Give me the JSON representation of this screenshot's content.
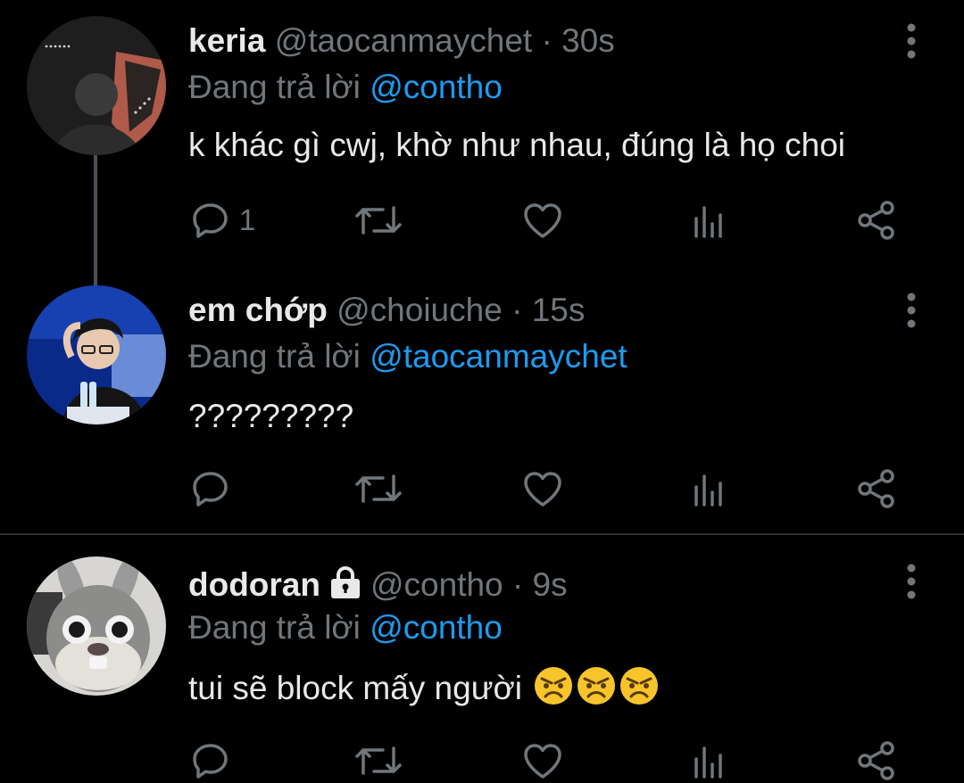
{
  "tweets": [
    {
      "name": "keria",
      "handle": "@taocanmaychet",
      "separator": "·",
      "time": "30s",
      "reply_prefix": "Đang trả lời",
      "reply_to": "@contho",
      "text": "k khác gì cwj, khờ như nhau, đúng là họ choi",
      "reply_count": "1",
      "locked": false
    },
    {
      "name": "em chớp",
      "handle": "@choiuche",
      "separator": "·",
      "time": "15s",
      "reply_prefix": "Đang trả lời",
      "reply_to": "@taocanmaychet",
      "text": "?????????",
      "reply_count": "",
      "locked": false
    },
    {
      "name": "dodoran",
      "handle": "@contho",
      "separator": "·",
      "time": "9s",
      "reply_prefix": "Đang trả lời",
      "reply_to": "@contho",
      "text": "tui sẽ block mấy người",
      "reply_count": "",
      "locked": true,
      "emojis": [
        "angry-face",
        "angry-face",
        "angry-face"
      ]
    }
  ],
  "icons": {
    "reply": "reply-icon",
    "retweet": "retweet-icon",
    "like": "heart-icon",
    "analytics": "analytics-icon",
    "share": "share-icon",
    "more": "more-icon",
    "lock": "lock-icon"
  },
  "colors": {
    "background": "#000000",
    "text": "#e7e9ea",
    "secondary": "#71767b",
    "mention": "#1d9bf0",
    "divider": "#2f3336",
    "thread_line": "#4b5159"
  }
}
